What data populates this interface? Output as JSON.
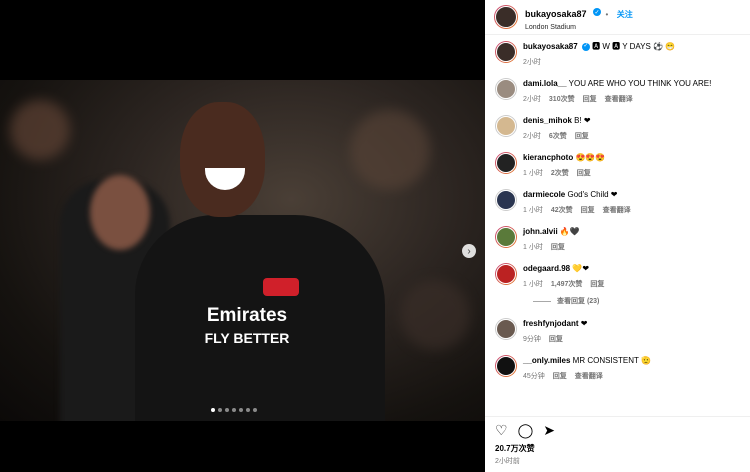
{
  "post": {
    "username": "bukayosaka87",
    "follow_label": "关注",
    "location": "London Stadium",
    "verified_mark": "✓",
    "next_icon": "›"
  },
  "caption": {
    "username": "bukayosaka87",
    "text": "🅰 W 🅰 Y DAYS ⚽ 😁",
    "time": "2小时"
  },
  "comments": [
    {
      "user": "dami.lola__",
      "text": "YOU ARE WHO YOU THINK YOU ARE!",
      "time": "2小时",
      "likes": "310次赞",
      "reply": "回复",
      "translate": "查看翻译"
    },
    {
      "user": "denis_mihok",
      "text": "B! ❤",
      "time": "2小时",
      "likes": "6次赞",
      "reply": "回复",
      "translate": ""
    },
    {
      "user": "kierancphoto",
      "text": "😍😍😍",
      "time": "1 小时",
      "likes": "2次赞",
      "reply": "回复",
      "translate": ""
    },
    {
      "user": "darmiecole",
      "text": "God's Child ❤",
      "time": "1 小时",
      "likes": "42次赞",
      "reply": "回复",
      "translate": "查看翻译"
    },
    {
      "user": "john.alvii",
      "text": "🔥🖤",
      "time": "1 小时",
      "likes": "",
      "reply": "回复",
      "translate": ""
    },
    {
      "user": "odegaard.98",
      "text": "💛❤",
      "time": "1 小时",
      "likes": "1,497次赞",
      "reply": "回复",
      "translate": ""
    },
    {
      "user": "freshfynjodant",
      "text": "❤",
      "time": "9分钟",
      "likes": "",
      "reply": "回复",
      "translate": ""
    },
    {
      "user": "__only.miles",
      "text": "MR CONSISTENT 🫡",
      "time": "45分钟",
      "likes": "",
      "reply": "回复",
      "translate": "查看翻译"
    }
  ],
  "view_replies": "查看回复 (23)",
  "footer": {
    "like_icon": "♡",
    "comment_icon": "◯",
    "share_icon": "➤",
    "likes": "20.7万次赞",
    "time": "2小时前"
  }
}
